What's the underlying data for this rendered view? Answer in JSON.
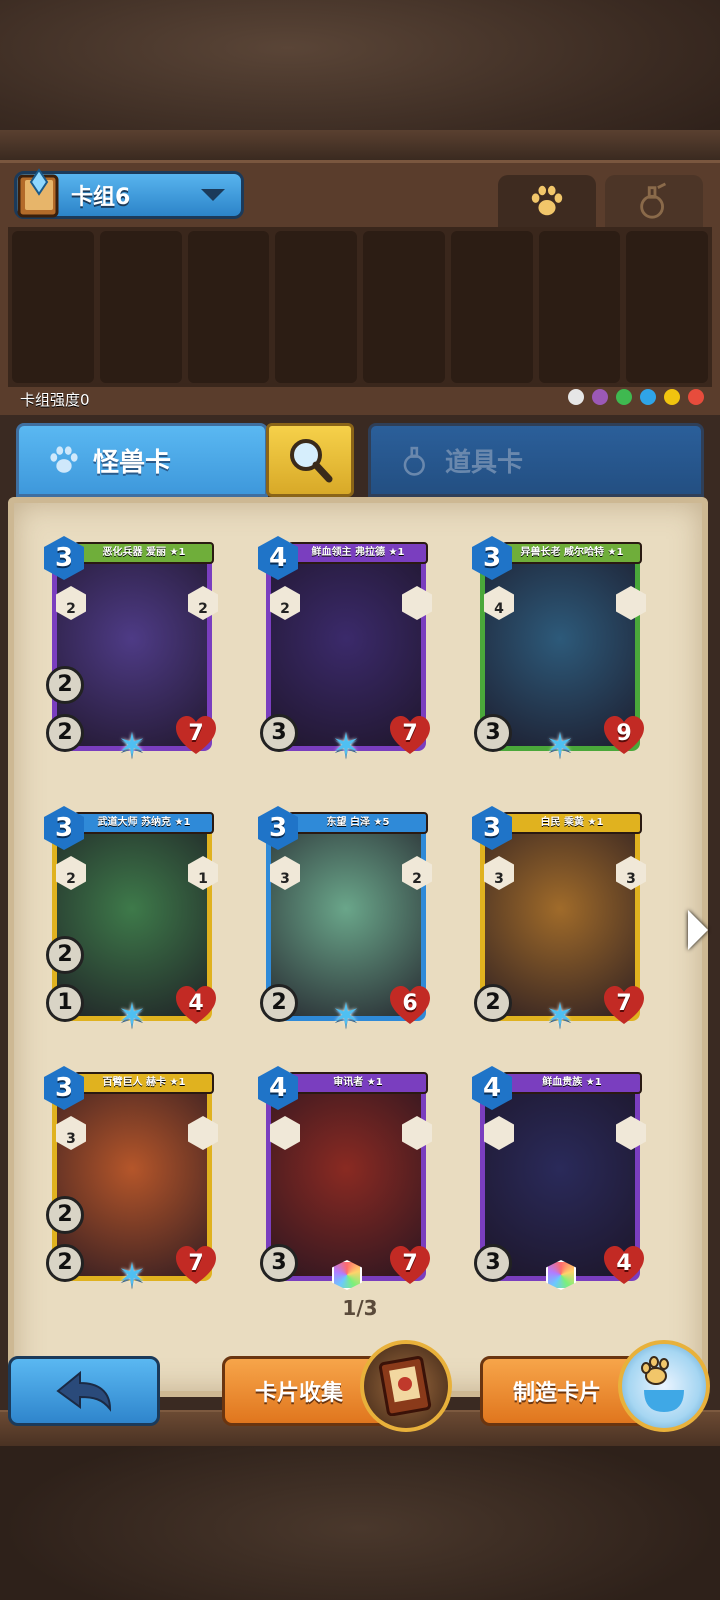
{
  "deck": {
    "selected": "卡组6",
    "strength_label": "卡组强度0",
    "slots": 8,
    "elements": [
      "#e6e6e6",
      "#9b59b6",
      "#3fb950",
      "#2fa4e7",
      "#f1c40f",
      "#e74c3c"
    ]
  },
  "tabs": {
    "monster": "怪兽卡",
    "item": "道具卡"
  },
  "cards": [
    {
      "name": "恶化兵器 爱丽 ★1",
      "cost": "3",
      "attack": "2",
      "speed": "2",
      "hp": "7",
      "skills": [
        "2",
        "2"
      ],
      "frame": "#7a3ebf",
      "banner": "#6fae3a",
      "art": "#4e3b86",
      "bottom": "star"
    },
    {
      "name": "鲜血领主 弗拉德 ★1",
      "cost": "4",
      "attack": "3",
      "speed": "",
      "hp": "7",
      "skills": [
        "2",
        ""
      ],
      "frame": "#7a3ebf",
      "banner": "#7a3ebf",
      "art": "#3b2a6b",
      "bottom": "star"
    },
    {
      "name": "异兽长老 威尔哈特 ★1",
      "cost": "3",
      "attack": "3",
      "speed": "",
      "hp": "9",
      "skills": [
        "4",
        ""
      ],
      "frame": "#4aa83a",
      "banner": "#6fae3a",
      "art": "#2d5a7a",
      "bottom": "star"
    },
    {
      "name": "武道大师 苏纳克 ★1",
      "cost": "3",
      "attack": "1",
      "speed": "2",
      "hp": "4",
      "skills": [
        "2",
        "1"
      ],
      "frame": "#e0b21f",
      "banner": "#2f8ad8",
      "art": "#3e7a4a",
      "bottom": "star"
    },
    {
      "name": "东望 白泽 ★5",
      "cost": "3",
      "attack": "2",
      "speed": "",
      "hp": "6",
      "skills": [
        "3",
        "2"
      ],
      "frame": "#2f8ad8",
      "banner": "#2f8ad8",
      "art": "#6aa68a",
      "bottom": "star"
    },
    {
      "name": "白民 乘黄 ★1",
      "cost": "3",
      "attack": "2",
      "speed": "",
      "hp": "7",
      "skills": [
        "3",
        "3"
      ],
      "frame": "#e0b21f",
      "banner": "#e0b21f",
      "art": "#a06b2a",
      "bottom": "star"
    },
    {
      "name": "百臂巨人 赫卡 ★1",
      "cost": "3",
      "attack": "2",
      "speed": "2",
      "hp": "7",
      "skills": [
        "3",
        ""
      ],
      "frame": "#e0b21f",
      "banner": "#e0b21f",
      "art": "#b5562a",
      "bottom": "star"
    },
    {
      "name": "审讯者 ★1",
      "cost": "4",
      "attack": "3",
      "speed": "",
      "hp": "7",
      "skills": [
        "",
        ""
      ],
      "frame": "#7a3ebf",
      "banner": "#7a3ebf",
      "art": "#8a2a22",
      "bottom": "gem"
    },
    {
      "name": "鲜血贵族 ★1",
      "cost": "4",
      "attack": "3",
      "speed": "",
      "hp": "4",
      "skills": [
        "",
        ""
      ],
      "frame": "#7a3ebf",
      "banner": "#7a3ebf",
      "art": "#2a2a5a",
      "bottom": "gem"
    }
  ],
  "pagination": "1/3",
  "buttons": {
    "collect": "卡片收集",
    "craft": "制造卡片"
  }
}
